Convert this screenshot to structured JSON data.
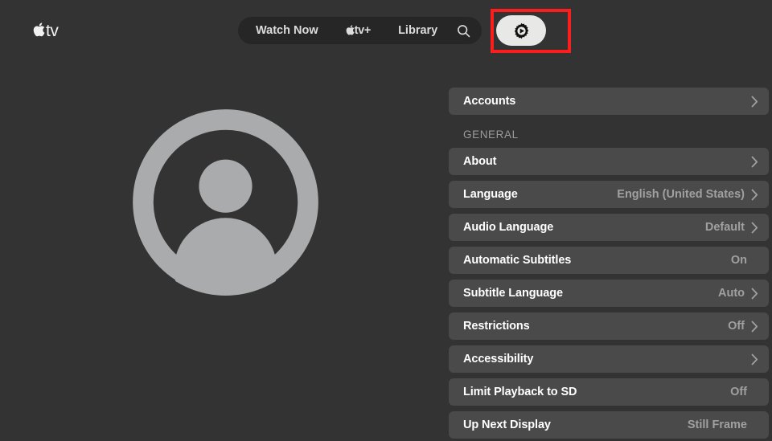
{
  "brand": {
    "apple_icon": "apple-logo-icon",
    "text": "tv"
  },
  "nav": {
    "items": [
      {
        "label": "Watch Now",
        "name": "nav-watch-now"
      },
      {
        "label": "tv+",
        "name": "nav-tvplus"
      },
      {
        "label": "Library",
        "name": "nav-library"
      }
    ],
    "watch_now": "Watch Now",
    "tvplus": "tv+",
    "library": "Library",
    "search_icon": "search-icon",
    "settings_icon": "settings-gear-play-icon"
  },
  "highlight": {
    "color": "#fc1d1d",
    "target": "settings-button"
  },
  "avatar": {
    "icon": "user-profile-icon",
    "color": "#a9abad"
  },
  "colors": {
    "page_background": "#333333",
    "row_background": "#4a4a4a",
    "nav_pill_background": "#262626",
    "settings_button_background": "#e8e8e6",
    "value_text": "#a0a0a0",
    "section_label": "#9a9a9a",
    "highlight_red": "#fc1d1d"
  },
  "settings": {
    "top_rows": [
      {
        "label": "Accounts",
        "value": "",
        "chevron": true
      }
    ],
    "general_section_label": "GENERAL",
    "general_rows": [
      {
        "label": "About",
        "value": "",
        "chevron": true
      },
      {
        "label": "Language",
        "value": "English (United States)",
        "chevron": true
      },
      {
        "label": "Audio Language",
        "value": "Default",
        "chevron": true
      },
      {
        "label": "Automatic Subtitles",
        "value": "On",
        "chevron": false
      },
      {
        "label": "Subtitle Language",
        "value": "Auto",
        "chevron": true
      },
      {
        "label": "Restrictions",
        "value": "Off",
        "chevron": true
      },
      {
        "label": "Accessibility",
        "value": "",
        "chevron": true
      },
      {
        "label": "Limit Playback to SD",
        "value": "Off",
        "chevron": false
      },
      {
        "label": "Up Next Display",
        "value": "Still Frame",
        "chevron": false
      }
    ]
  }
}
